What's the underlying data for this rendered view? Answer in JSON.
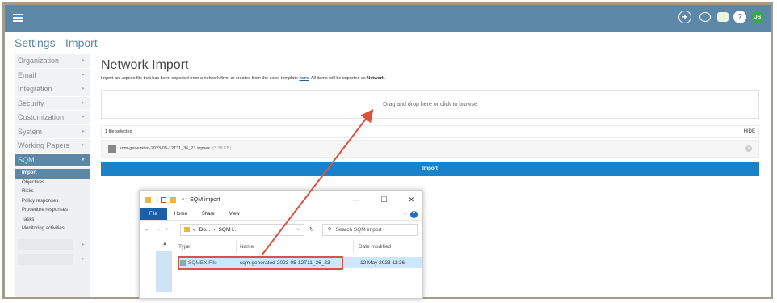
{
  "app": {
    "page_title": "Settings - Import",
    "top_icons": [
      "plus-circle-icon",
      "search-icon",
      "chat-icon",
      "help-icon",
      "user-avatar-icon"
    ],
    "user_initials": "JS",
    "accent": "#5d87a7"
  },
  "sidebar": {
    "items": [
      {
        "label": "Organization"
      },
      {
        "label": "Email"
      },
      {
        "label": "Integration"
      },
      {
        "label": "Security"
      },
      {
        "label": "Customization"
      },
      {
        "label": "System"
      },
      {
        "label": "Working Papers"
      },
      {
        "label": "SQM"
      }
    ],
    "subitems": [
      {
        "label": "Import"
      },
      {
        "label": "Objectives"
      },
      {
        "label": "Risks"
      },
      {
        "label": "Policy responses"
      },
      {
        "label": "Procedure responses"
      },
      {
        "label": "Tasks"
      },
      {
        "label": "Monitoring activities"
      }
    ],
    "arrow": "►",
    "arrow_down": "▼"
  },
  "main": {
    "heading": "Network Import",
    "desc_before": "Import an .sqmex file that has been exported from a network firm, or created from the excel template ",
    "desc_link": "here",
    "desc_after": ". All items will be imported as ",
    "desc_bold": "Network",
    "desc_end": ".",
    "dropzone_text": "Drag and drop here or click to browse",
    "selected_count": "1 file selected",
    "hide_label": "HIDE",
    "file_name": "sqm-generated-2023-05-12T11_36_23.sqmex",
    "file_size": "(3.38 KB)",
    "import_label": "Import",
    "import_color": "#1a82c8"
  },
  "explorer": {
    "title": "SQM import",
    "tabs": [
      "File",
      "Home",
      "Share",
      "View"
    ],
    "path_1": "Do...",
    "path_2": "SQM i...",
    "search_placeholder": "Search SQM import",
    "col_type": "Type",
    "col_name": "Name",
    "col_date": "Date modified",
    "file_type": "SQMEX File",
    "file_name": "sqm-generated-2023-05-12T11_36_23",
    "file_date": "12 May 2023 11:36"
  },
  "annotation_color": "#e0503e"
}
